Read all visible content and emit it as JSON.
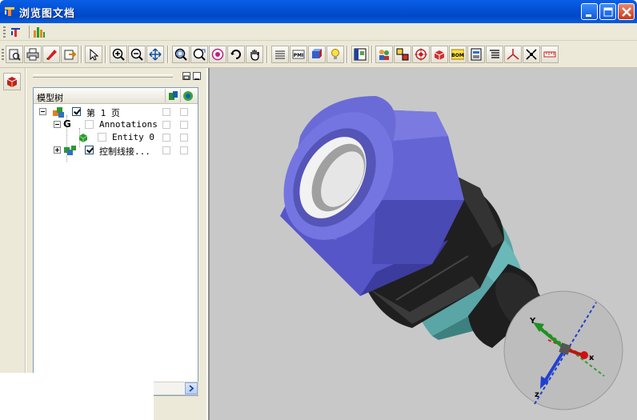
{
  "window": {
    "title": "浏览图文档",
    "minimize_label": "minimize",
    "maximize_label": "maximize",
    "close_label": "close"
  },
  "colors": {
    "titlebar": "#0251d6",
    "chrome": "#ece9d8",
    "viewport_bg": "#c8c8c8",
    "nut_blue": "#6e6ed8",
    "body_black": "#222222",
    "ring_teal": "#5aa5a5"
  },
  "menu_icons": [
    "menu-app-icon",
    "menu-chart-icon"
  ],
  "toolbar": {
    "buttons": [
      "print-preview-icon",
      "print-icon",
      "markup-pen-icon",
      "export-icon",
      "select-arrow-icon",
      "zoom-in-icon",
      "zoom-out-icon",
      "pan-move-icon",
      "zoom-window-icon",
      "zoom-fit-icon",
      "zoom-target-icon",
      "rotate-icon",
      "hand-pan-icon",
      "layers-icon",
      "pmi-icon",
      "model-icon",
      "lightbulb-icon",
      "panel-toggle-icon",
      "people-icon",
      "measure-icon",
      "target-section-icon",
      "cube-icon",
      "bom-icon",
      "report-icon",
      "list-icon",
      "axis-icon",
      "explode-icon",
      "ruler-icon"
    ],
    "pmi_label": "PMI",
    "bom_label": "BOM"
  },
  "left_strip": {
    "button": "cube-view-icon"
  },
  "panel": {
    "header_label": "模型树",
    "rows": [
      {
        "label": "第 1 页",
        "checked": true,
        "icon": "page-assembly-icon"
      },
      {
        "label": "Annotations",
        "checked": false,
        "icon": "annotation-g-icon"
      },
      {
        "label": "Entity 0",
        "checked": false,
        "icon": "entity-cube-icon"
      },
      {
        "label": "控制线接...",
        "checked": true,
        "icon": "part-assembly-icon"
      }
    ]
  },
  "viewport": {
    "axis_labels": {
      "x": "x",
      "y": "Y",
      "z": "z"
    }
  }
}
